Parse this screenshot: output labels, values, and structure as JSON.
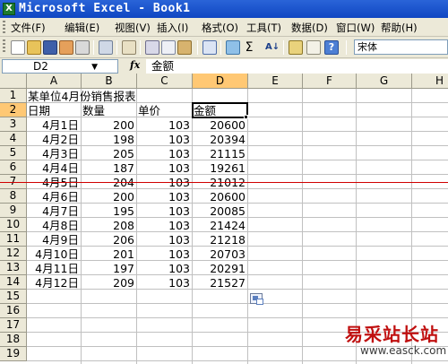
{
  "window": {
    "title": "Microsoft Excel - Book1",
    "icon_text": "X"
  },
  "menu": [
    {
      "name": "file",
      "label": "文件(F)"
    },
    {
      "name": "edit",
      "label": "编辑(E)"
    },
    {
      "name": "view",
      "label": "视图(V)"
    },
    {
      "name": "insert",
      "label": "插入(I)"
    },
    {
      "name": "format",
      "label": "格式(O)"
    },
    {
      "name": "tools",
      "label": "工具(T)"
    },
    {
      "name": "data",
      "label": "数据(D)"
    },
    {
      "name": "window",
      "label": "窗口(W)"
    },
    {
      "name": "help",
      "label": "帮助(H)"
    }
  ],
  "toolbar": {
    "font_name": "宋体",
    "icons": [
      "new-icon",
      "open-icon",
      "save-icon",
      "permission-icon",
      "print-icon",
      "print-preview-icon",
      "spelling-icon",
      "cut-icon",
      "copy-icon",
      "paste-icon",
      "undo-icon",
      "hyperlink-icon",
      "autosum-icon",
      "sort-ascending-icon",
      "chart-wizard-icon",
      "help-icon"
    ]
  },
  "formula_bar": {
    "name_box": "D2",
    "fx_label": "fx",
    "formula": "金额"
  },
  "sheet": {
    "active_cell": "D2",
    "columns": [
      "A",
      "B",
      "C",
      "D",
      "E",
      "F",
      "G",
      "H"
    ],
    "rows": [
      "1",
      "2",
      "3",
      "4",
      "5",
      "6",
      "7",
      "8",
      "9",
      "10",
      "11",
      "12",
      "13",
      "14",
      "15",
      "16",
      "17",
      "18",
      "19"
    ],
    "title": "某单位4月份销售报表",
    "headers": [
      "日期",
      "数量",
      "单价",
      "金额"
    ],
    "data": [
      [
        "4月1日",
        "200",
        "103",
        "20600"
      ],
      [
        "4月2日",
        "198",
        "103",
        "20394"
      ],
      [
        "4月3日",
        "205",
        "103",
        "21115"
      ],
      [
        "4月4日",
        "187",
        "103",
        "19261"
      ],
      [
        "4月5日",
        "204",
        "103",
        "21012"
      ],
      [
        "4月6日",
        "200",
        "103",
        "20600"
      ],
      [
        "4月7日",
        "195",
        "103",
        "20085"
      ],
      [
        "4月8日",
        "208",
        "103",
        "21424"
      ],
      [
        "4月9日",
        "206",
        "103",
        "21218"
      ],
      [
        "4月10日",
        "201",
        "103",
        "20703"
      ],
      [
        "4月11日",
        "197",
        "103",
        "20291"
      ],
      [
        "4月12日",
        "209",
        "103",
        "21527"
      ]
    ]
  },
  "watermark": {
    "text": "易采站长站",
    "url": "www.easck.com"
  },
  "colors": {
    "title_bar": "#0f46c2",
    "active_header": "#ffc874",
    "red_line": "#d00000"
  }
}
